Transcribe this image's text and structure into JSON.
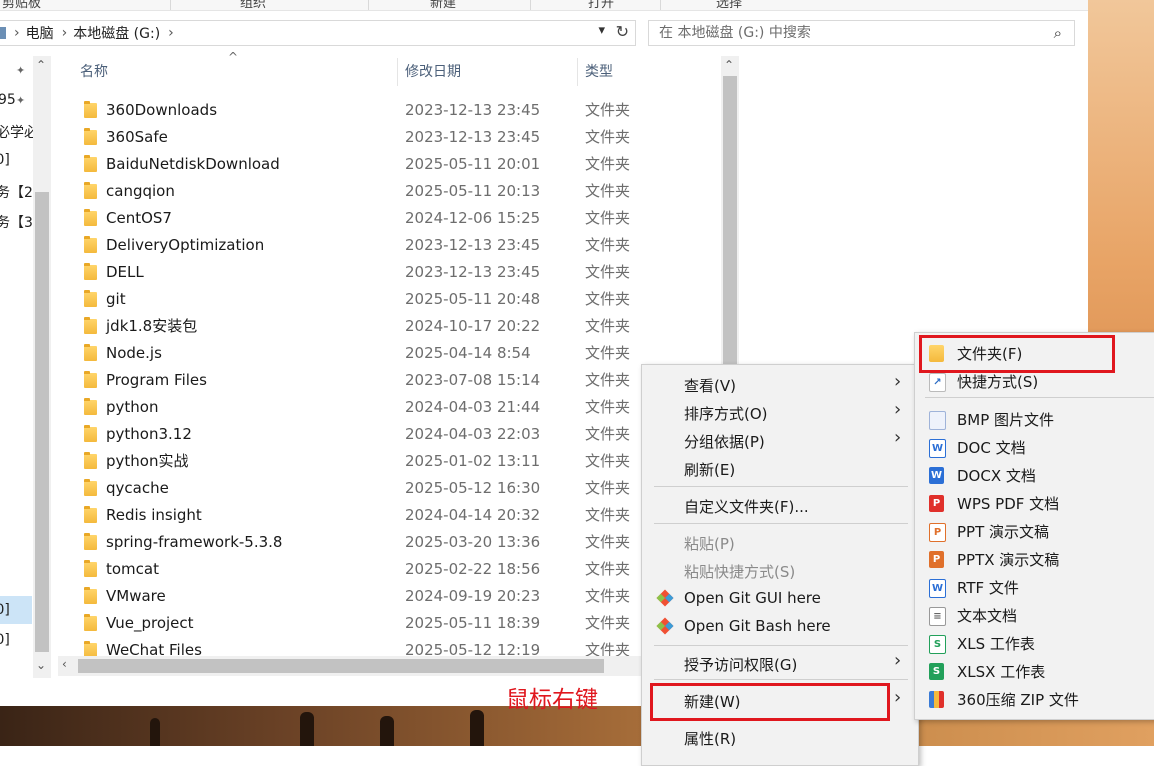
{
  "ribbon": {
    "tabs": [
      "剪贴板",
      "组织",
      "新建",
      "打开",
      "选择"
    ]
  },
  "address": {
    "crumbs": [
      "电脑",
      "本地磁盘 (G:)"
    ],
    "search_placeholder": "在 本地磁盘 (G:) 中搜索"
  },
  "nav": {
    "items": [
      "95",
      "必学必",
      "[0]",
      "务【2",
      "务【3",
      "[0]",
      "[0]"
    ]
  },
  "columns": {
    "name": "名称",
    "date": "修改日期",
    "type": "类型"
  },
  "files": [
    {
      "name": "360Downloads",
      "date": "2023-12-13 23:45",
      "type": "文件夹"
    },
    {
      "name": "360Safe",
      "date": "2023-12-13 23:45",
      "type": "文件夹"
    },
    {
      "name": "BaiduNetdiskDownload",
      "date": "2025-05-11 20:01",
      "type": "文件夹"
    },
    {
      "name": "cangqion",
      "date": "2025-05-11 20:13",
      "type": "文件夹"
    },
    {
      "name": "CentOS7",
      "date": "2024-12-06 15:25",
      "type": "文件夹"
    },
    {
      "name": "DeliveryOptimization",
      "date": "2023-12-13 23:45",
      "type": "文件夹"
    },
    {
      "name": "DELL",
      "date": "2023-12-13 23:45",
      "type": "文件夹"
    },
    {
      "name": "git",
      "date": "2025-05-11 20:48",
      "type": "文件夹"
    },
    {
      "name": "jdk1.8安装包",
      "date": "2024-10-17 20:22",
      "type": "文件夹"
    },
    {
      "name": "Node.js",
      "date": "2025-04-14 8:54",
      "type": "文件夹"
    },
    {
      "name": "Program Files",
      "date": "2023-07-08 15:14",
      "type": "文件夹"
    },
    {
      "name": "python",
      "date": "2024-04-03 21:44",
      "type": "文件夹"
    },
    {
      "name": "python3.12",
      "date": "2024-04-03 22:03",
      "type": "文件夹"
    },
    {
      "name": "python实战",
      "date": "2025-01-02 13:11",
      "type": "文件夹"
    },
    {
      "name": "qycache",
      "date": "2025-05-12 16:30",
      "type": "文件夹"
    },
    {
      "name": "Redis insight",
      "date": "2024-04-14 20:32",
      "type": "文件夹"
    },
    {
      "name": "spring-framework-5.3.8",
      "date": "2025-03-20 13:36",
      "type": "文件夹"
    },
    {
      "name": "tomcat",
      "date": "2025-02-22 18:56",
      "type": "文件夹"
    },
    {
      "name": "VMware",
      "date": "2024-09-19 20:23",
      "type": "文件夹"
    },
    {
      "name": "Vue_project",
      "date": "2025-05-11 18:39",
      "type": "文件夹"
    },
    {
      "name": "WeChat Files",
      "date": "2025-05-12 12:19",
      "type": "文件夹"
    }
  ],
  "context_menu": {
    "view": "查看(V)",
    "sort": "排序方式(O)",
    "group": "分组依据(P)",
    "refresh": "刷新(E)",
    "customize": "自定义文件夹(F)...",
    "paste": "粘贴(P)",
    "paste_shortcut": "粘贴快捷方式(S)",
    "git_gui": "Open Git GUI here",
    "git_bash": "Open Git Bash here",
    "access": "授予访问权限(G)",
    "new": "新建(W)",
    "properties": "属性(R)"
  },
  "new_submenu": {
    "items": [
      {
        "label": "文件夹(F)",
        "icon": "folder-icon"
      },
      {
        "label": "快捷方式(S)",
        "icon": "shortcut-icon"
      },
      {
        "label": "BMP 图片文件",
        "icon": "bmp-icon"
      },
      {
        "label": "DOC 文档",
        "icon": "doc-icon"
      },
      {
        "label": "DOCX 文档",
        "icon": "docx-icon"
      },
      {
        "label": "WPS PDF 文档",
        "icon": "pdf-icon"
      },
      {
        "label": "PPT 演示文稿",
        "icon": "ppt-icon"
      },
      {
        "label": "PPTX 演示文稿",
        "icon": "pptx-icon"
      },
      {
        "label": "RTF 文件",
        "icon": "rtf-icon"
      },
      {
        "label": "文本文档",
        "icon": "txt-icon"
      },
      {
        "label": "XLS 工作表",
        "icon": "xls-icon"
      },
      {
        "label": "XLSX 工作表",
        "icon": "xlsx-icon"
      },
      {
        "label": "360压缩 ZIP 文件",
        "icon": "zip-icon"
      }
    ]
  },
  "annotation": "鼠标右键",
  "colors": {
    "highlight": "#e0171e",
    "folder": "#f4b93c",
    "menu_bg": "#f2f2f2"
  }
}
